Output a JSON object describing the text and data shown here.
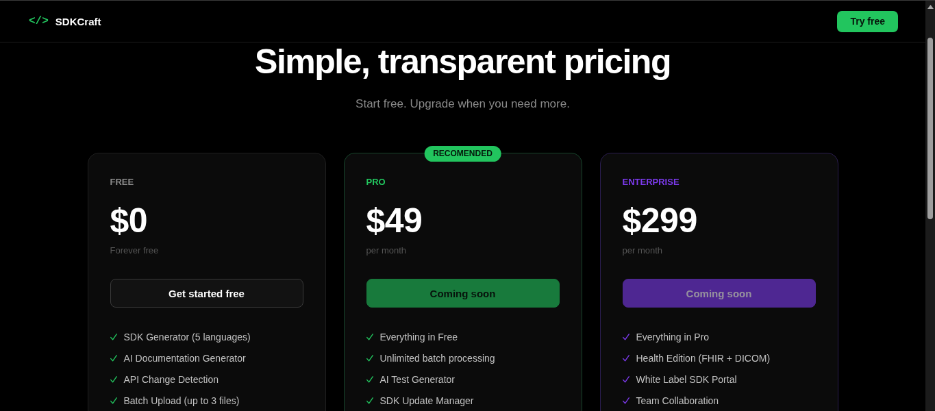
{
  "nav": {
    "logo_mark": "</>",
    "logo_name": "SDKCraft",
    "cta": "Try free"
  },
  "hero": {
    "title": "Simple, transparent pricing",
    "subtitle": "Start free. Upgrade when you need more."
  },
  "plans": [
    {
      "kind": "free",
      "name": "FREE",
      "price": "$0",
      "period": "Forever free",
      "button": {
        "label": "Get started free",
        "disabled": false
      },
      "features": [
        "SDK Generator (5 languages)",
        "AI Documentation Generator",
        "API Change Detection",
        "Batch Upload (up to 3 files)"
      ]
    },
    {
      "kind": "pro",
      "badge": "RECOMENDED",
      "name": "PRO",
      "price": "$49",
      "period": "per month",
      "button": {
        "label": "Coming soon",
        "disabled": true
      },
      "features": [
        "Everything in Free",
        "Unlimited batch processing",
        "AI Test Generator",
        "SDK Update Manager"
      ]
    },
    {
      "kind": "enterprise",
      "name": "ENTERPRISE",
      "price": "$299",
      "period": "per month",
      "button": {
        "label": "Coming soon",
        "disabled": true
      },
      "features": [
        "Everything in Pro",
        "Health Edition (FHIR + DICOM)",
        "White Label SDK Portal",
        "Team Collaboration"
      ]
    }
  ]
}
